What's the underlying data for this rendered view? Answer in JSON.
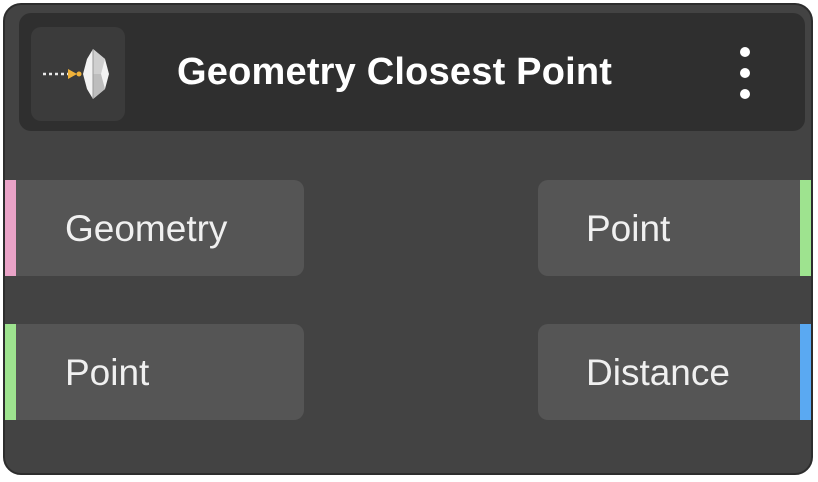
{
  "node": {
    "title": "Geometry Closest Point",
    "icon": "geometry-closest-point-icon",
    "menu_icon": "more-vertical-icon"
  },
  "inputs": [
    {
      "label": "Geometry",
      "color": "#e9a3c7"
    },
    {
      "label": "Point",
      "color": "#9ee38f"
    }
  ],
  "outputs": [
    {
      "label": "Point",
      "color": "#9ee38f"
    },
    {
      "label": "Distance",
      "color": "#5aa9f2"
    }
  ]
}
